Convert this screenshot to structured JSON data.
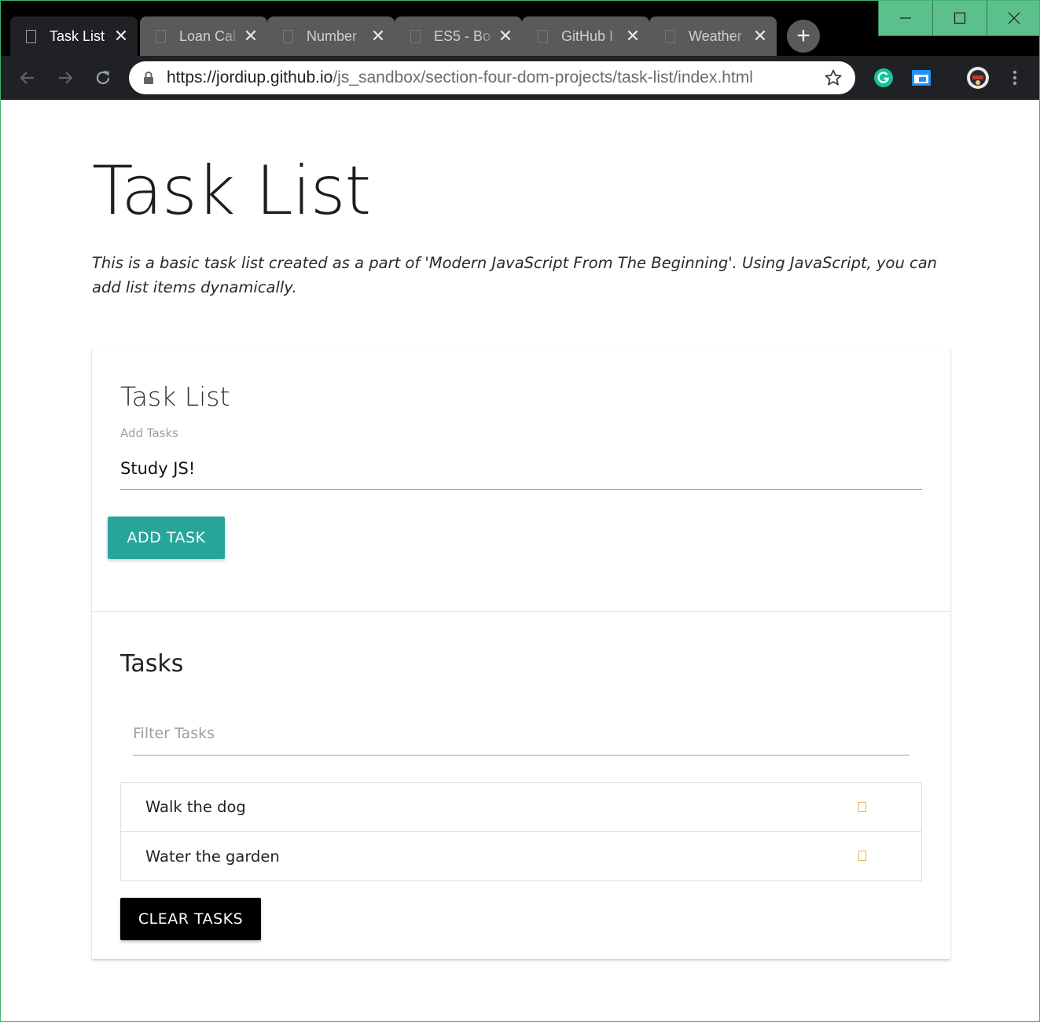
{
  "browser": {
    "tabs": [
      {
        "title": "Task List",
        "active": true
      },
      {
        "title": "Loan Cal",
        "active": false
      },
      {
        "title": "Number",
        "active": false
      },
      {
        "title": "ES5 - Bo",
        "active": false
      },
      {
        "title": "GitHub I",
        "active": false
      },
      {
        "title": "Weather",
        "active": false
      }
    ],
    "tab_close_glyph": "✕",
    "new_tab_glyph": "+",
    "url_host": "https://jordiup.github.io",
    "url_path": "/js_sandbox/section-four-dom-projects/task-list/index.html",
    "colors": {
      "tabstrip": "#000000",
      "toolbar": "#202124",
      "window_controls": "#5cc08c",
      "grammarly": "#15c39a"
    }
  },
  "page": {
    "title": "Task List",
    "lead": "This is a basic task list created as a part of 'Modern JavaScript From The Beginning'. Using JavaScript, you can add list items dynamically."
  },
  "card": {
    "title": "Task List",
    "input_label": "Add Tasks",
    "input_value": "Study JS!",
    "add_button": "ADD TASK",
    "tasks_title": "Tasks",
    "filter_placeholder": "Filter Tasks",
    "tasks": [
      "Walk the dog",
      "Water the garden"
    ],
    "clear_button": "CLEAR TASKS",
    "colors": {
      "accent": "#26a69a",
      "delete_icon": "#e6b15c",
      "clear_button": "#000000"
    }
  }
}
